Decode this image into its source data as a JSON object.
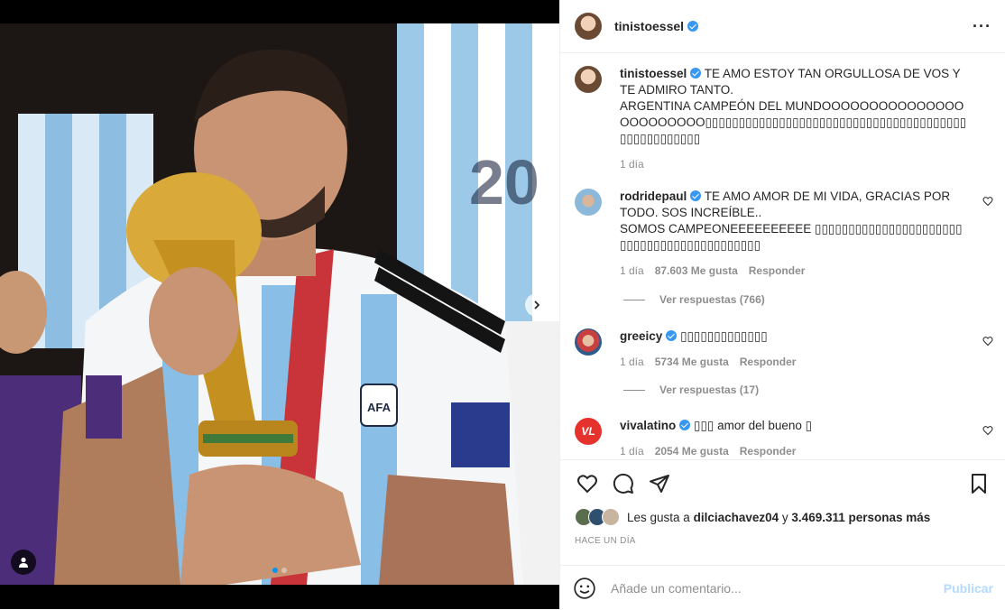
{
  "post": {
    "author": "tinistoessel",
    "more_icon": "more-horizontal-icon"
  },
  "caption": {
    "username": "tinistoessel",
    "text": "TE AMO ESTOY TAN ORGULLOSA DE VOS Y TE ADMIRO TANTO.",
    "text2": "ARGENTINA CAMPEÓN DEL MUNDOOOOOOOOOOOOOOOOOOOOOOOO▯▯▯▯▯▯▯▯▯▯▯▯▯▯▯▯▯▯▯▯▯▯▯▯▯▯▯▯▯▯▯▯▯▯▯▯▯▯▯▯▯▯▯▯▯▯▯▯▯▯▯",
    "time": "1 día"
  },
  "comments": [
    {
      "username": "rodridepaul",
      "text": "TE AMO AMOR DE MI VIDA, GRACIAS POR TODO. SOS INCREÍBLE..",
      "text2": "SOMOS CAMPEONEEEEEEEEEE ▯▯▯▯▯▯▯▯▯▯▯▯▯▯▯▯▯▯▯▯▯▯▯▯▯▯▯▯▯▯▯▯▯▯▯▯▯▯▯▯▯▯▯",
      "time": "1 día",
      "likes": "87.603 Me gusta",
      "reply": "Responder",
      "view_replies": "Ver respuestas (766)"
    },
    {
      "username": "greeicy",
      "text": "▯▯▯▯▯▯▯▯▯▯▯▯▯",
      "time": "1 día",
      "likes": "5734 Me gusta",
      "reply": "Responder",
      "view_replies": "Ver respuestas (17)"
    },
    {
      "username": "vivalatino",
      "avatar_text": "VL",
      "text": "▯▯▯ amor del bueno ▯",
      "time": "1 día",
      "likes": "2054 Me gusta",
      "reply": "Responder"
    }
  ],
  "likes_summary": {
    "prefix": "Les gusta a",
    "user": "dilciachavez04",
    "connector": "y",
    "count": "3.469.311 personas más"
  },
  "posted_ago": "HACE UN DÍA",
  "add_comment": {
    "placeholder": "Añade un comentario...",
    "publish_label": "Publicar"
  },
  "colors": {
    "verified": "#3897f0",
    "publish_disabled": "#b3dbff",
    "carousel_active": "#0095f6",
    "vivalatino_brand": "#e5322d"
  }
}
